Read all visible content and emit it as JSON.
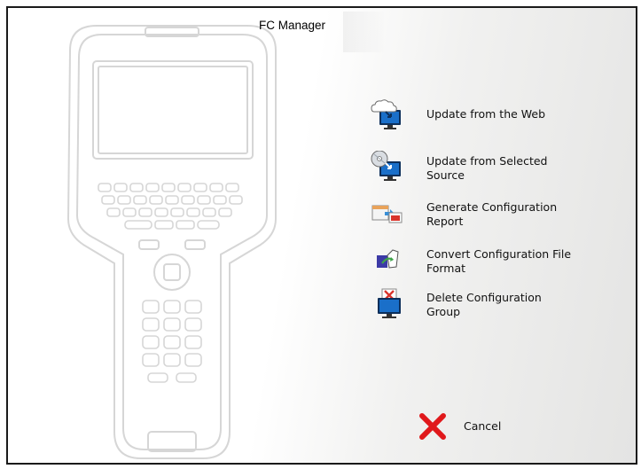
{
  "window": {
    "title": "FC Manager"
  },
  "menu": {
    "items": [
      {
        "label": "Update from the Web",
        "icon": "cloud-monitor-icon"
      },
      {
        "label": "Update from Selected Source",
        "icon": "disc-monitor-icon"
      },
      {
        "label": "Generate Configuration Report",
        "icon": "report-icon"
      },
      {
        "label": "Convert Configuration File Format",
        "icon": "convert-file-icon"
      },
      {
        "label": "Delete Configuration Group",
        "icon": "delete-monitor-icon"
      }
    ]
  },
  "cancel": {
    "label": "Cancel",
    "icon": "red-x-icon",
    "color": "#e0181b"
  },
  "colors": {
    "monitor_blue": "#1a6fc9",
    "monitor_dark": "#0d2f5a",
    "border": "#1a1a1a"
  }
}
